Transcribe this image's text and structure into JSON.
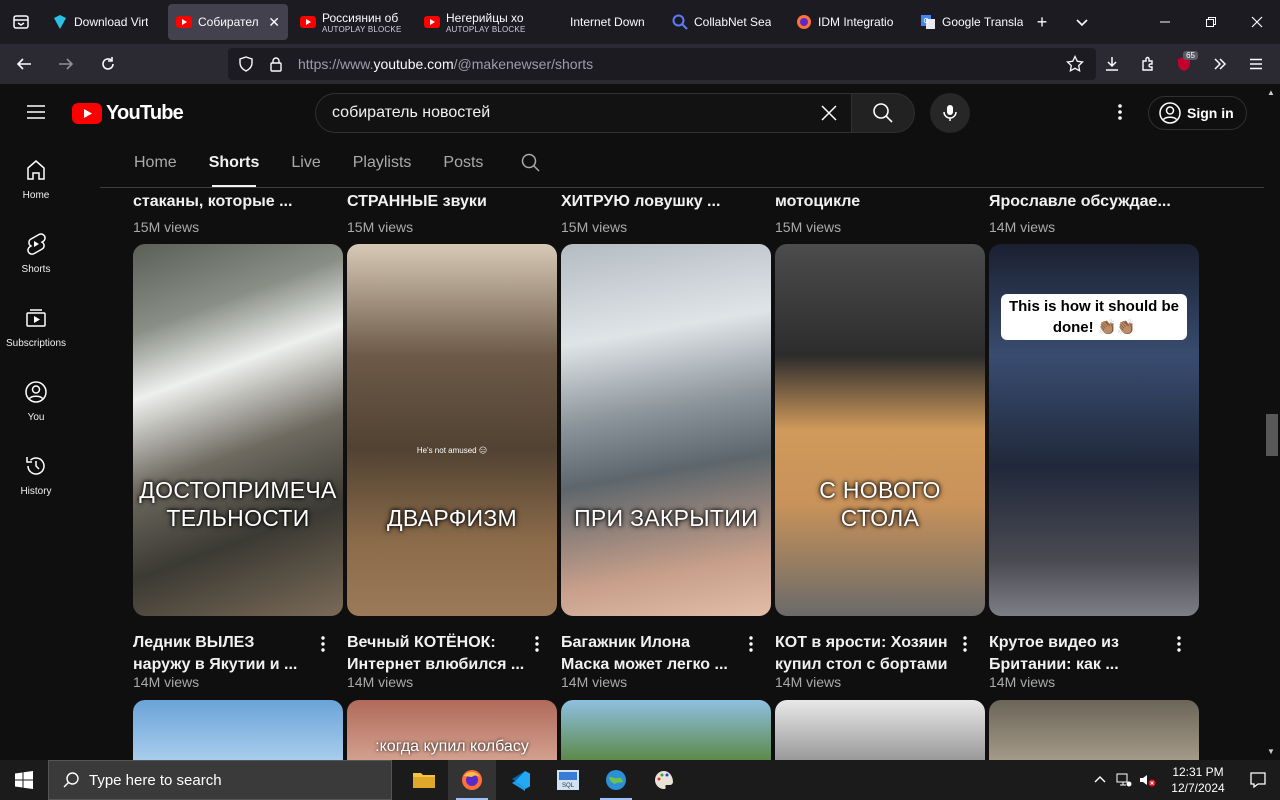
{
  "browser": {
    "tabs": [
      {
        "title": "Download Virt",
        "sub": "",
        "active": false,
        "favicon": "vpn-shield-icon"
      },
      {
        "title": "Собирател",
        "sub": "",
        "active": true,
        "favicon": "youtube-icon"
      },
      {
        "title": "Россиянин об",
        "sub": "AUTOPLAY BLOCKE",
        "active": false,
        "favicon": "youtube-icon"
      },
      {
        "title": "Негерийцы хо",
        "sub": "AUTOPLAY BLOCKE",
        "active": false,
        "favicon": "youtube-icon"
      },
      {
        "title": "Internet Down",
        "sub": "",
        "active": false,
        "favicon": "none"
      },
      {
        "title": "CollabNet Sea",
        "sub": "",
        "active": false,
        "favicon": "search-icon"
      },
      {
        "title": "IDM Integratio",
        "sub": "",
        "active": false,
        "favicon": "firefox-icon"
      },
      {
        "title": "Google Transla",
        "sub": "",
        "active": false,
        "favicon": "google-translate-icon"
      }
    ],
    "url_prefix": "https://www.",
    "url_host": "youtube.com",
    "url_path": "/@makenewser/shorts",
    "extension_badge": "65"
  },
  "youtube": {
    "logo_text": "YouTube",
    "search_value": "собиратель новостей",
    "sign_in": "Sign in",
    "sidebar": [
      {
        "label": "Home",
        "icon": "home-icon"
      },
      {
        "label": "Shorts",
        "icon": "shorts-icon"
      },
      {
        "label": "Subscriptions",
        "icon": "subscriptions-icon"
      },
      {
        "label": "You",
        "icon": "you-icon"
      },
      {
        "label": "History",
        "icon": "history-icon"
      }
    ],
    "channel_tabs": [
      "Home",
      "Shorts",
      "Live",
      "Playlists",
      "Posts"
    ],
    "active_tab": "Shorts",
    "prev_row": [
      {
        "title": "стаканы, которые ...",
        "views": "15M views"
      },
      {
        "title": "СТРАННЫЕ звуки",
        "views": "15M views"
      },
      {
        "title": "ХИТРУЮ ловушку  ...",
        "views": "15M views"
      },
      {
        "title": "мотоцикле",
        "views": "15M views"
      },
      {
        "title": "Ярославле обсуждае...",
        "views": "14M views"
      }
    ],
    "shorts": [
      {
        "caption": "ДОСТОПРИМЕЧА\nТЕЛЬНОСТИ",
        "title": "Ледник ВЫЛЕЗ наружу в Якутии и ...",
        "views": "14M views"
      },
      {
        "caption": "ДВАРФИЗМ",
        "note": "He's not amused 😑",
        "title": "Вечный КОТЁНОК: Интернет влюбился ...",
        "views": "14M views"
      },
      {
        "caption": "ПРИ ЗАКРЫТИИ",
        "title": "Багажник Илона Маска может легко ...",
        "views": "14M views"
      },
      {
        "caption": "С НОВОГО\nСТОЛА",
        "title": "КОТ в ярости: Хозяин купил стол с бортами",
        "views": "14M views"
      },
      {
        "top_caption": "This is how it should be done! 👏🏽👏🏽",
        "title": "Крутое видео из Британии: как ...",
        "views": "14M views"
      }
    ],
    "next_row_caption": ":когда купил колбасу"
  },
  "taskbar": {
    "search_placeholder": "Type here to search",
    "time": "12:31 PM",
    "date": "12/7/2024"
  }
}
